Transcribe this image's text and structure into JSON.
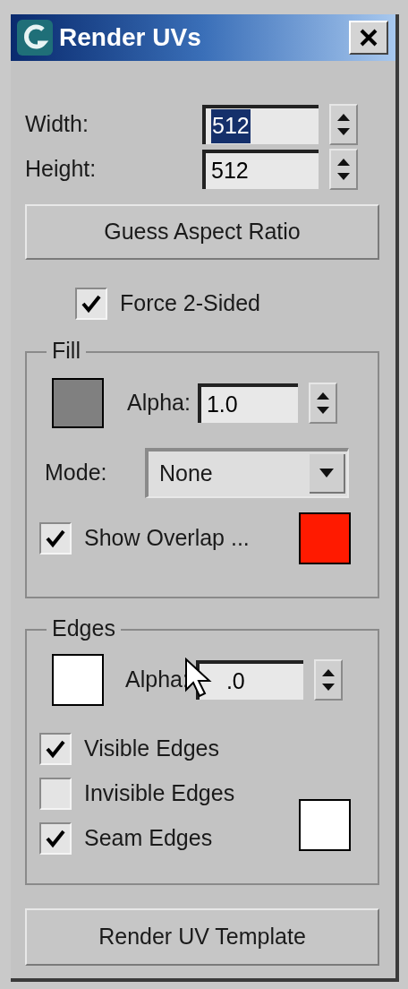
{
  "window": {
    "title": "Render UVs"
  },
  "size_fields": [
    {
      "label": "Width:",
      "value": "512",
      "selected": true
    },
    {
      "label": "Height:",
      "value": "512",
      "selected": false
    }
  ],
  "guess_button": "Guess Aspect Ratio",
  "force_two_sided": {
    "label": "Force 2-Sided",
    "checked": true
  },
  "fill": {
    "title": "Fill",
    "color": "#808080",
    "alpha_label": "Alpha:",
    "alpha_value": "1.0",
    "mode_label": "Mode:",
    "mode_value": "None",
    "show_overlap": {
      "label": "Show Overlap ...",
      "checked": true,
      "color": "#ff1a00"
    }
  },
  "edges": {
    "title": "Edges",
    "color": "#ffffff",
    "alpha_label": "Alpha:",
    "alpha_value": ".0",
    "options": [
      {
        "label": "Visible Edges",
        "checked": true
      },
      {
        "label": "Invisible Edges",
        "checked": false
      },
      {
        "label": "Seam Edges",
        "checked": true,
        "color": "#ffffff"
      }
    ]
  },
  "render_button": "Render UV Template"
}
